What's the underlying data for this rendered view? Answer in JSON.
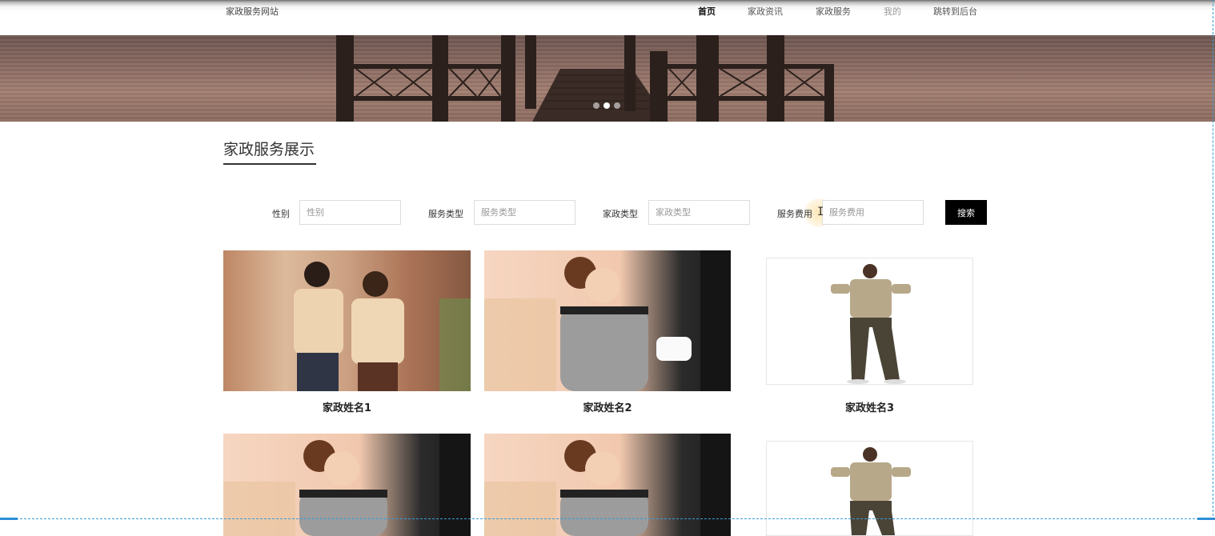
{
  "header": {
    "site_name": "家政服务网站",
    "nav": [
      {
        "label": "首页",
        "state": "active"
      },
      {
        "label": "家政资讯",
        "state": "normal"
      },
      {
        "label": "家政服务",
        "state": "normal"
      },
      {
        "label": "我的",
        "state": "muted"
      },
      {
        "label": "跳转到后台",
        "state": "normal"
      }
    ]
  },
  "banner": {
    "carousel_dots": 3,
    "active_dot": 2
  },
  "section": {
    "title": "家政服务展示"
  },
  "filters": {
    "gender": {
      "label": "性别",
      "placeholder": "性别",
      "value": ""
    },
    "service_type": {
      "label": "服务类型",
      "placeholder": "服务类型",
      "value": ""
    },
    "housekeeping_type": {
      "label": "家政类型",
      "placeholder": "家政类型",
      "value": ""
    },
    "service_fee": {
      "label": "服务费用",
      "placeholder": "服务费用",
      "value": ""
    },
    "search_button": "搜索"
  },
  "cards": [
    {
      "name": "家政姓名1",
      "image": "couple-uniform-photo"
    },
    {
      "name": "家政姓名2",
      "image": "maid-cleaning-photo"
    },
    {
      "name": "家政姓名3",
      "image": "worker-uniform-photo"
    },
    {
      "name": "",
      "image": "maid-cleaning-photo"
    },
    {
      "name": "",
      "image": "maid-cleaning-photo"
    },
    {
      "name": "",
      "image": "worker-uniform-photo"
    }
  ],
  "colors": {
    "accent_dark": "#000000",
    "selection_dashed": "#3a9bd9"
  }
}
